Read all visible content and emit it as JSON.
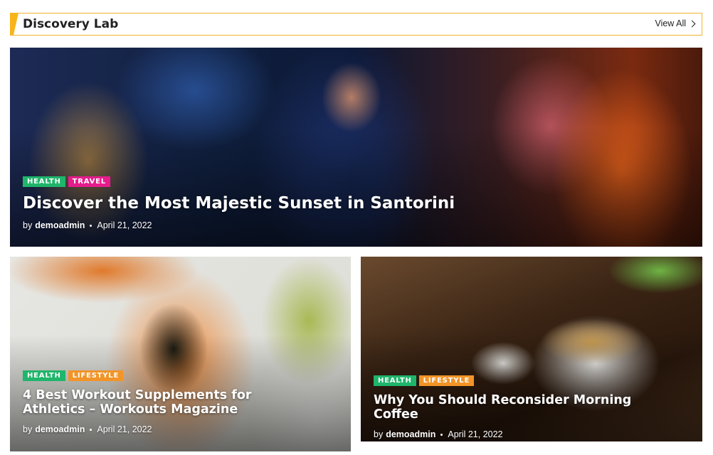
{
  "section": {
    "title": "Discovery Lab",
    "view_all": "View All"
  },
  "posts": [
    {
      "tags": [
        "HEALTH",
        "TRAVEL"
      ],
      "title": "Discover the Most Majestic Sunset in Santorini",
      "by": "by",
      "author": "demoadmin",
      "date": "April 21, 2022"
    },
    {
      "tags": [
        "HEALTH",
        "LIFESTYLE"
      ],
      "title": "4 Best Workout Supplements for Athletics – Workouts Magazine",
      "by": "by",
      "author": "demoadmin",
      "date": "April 21, 2022"
    },
    {
      "tags": [
        "HEALTH",
        "LIFESTYLE"
      ],
      "title": "Why You Should Reconsider Morning Coffee",
      "by": "by",
      "author": "demoadmin",
      "date": "April 21, 2022"
    }
  ],
  "colors": {
    "accent": "#f7b51b",
    "tag_health": "#1fb56b",
    "tag_travel": "#e61c8c",
    "tag_lifestyle": "#f29427"
  }
}
